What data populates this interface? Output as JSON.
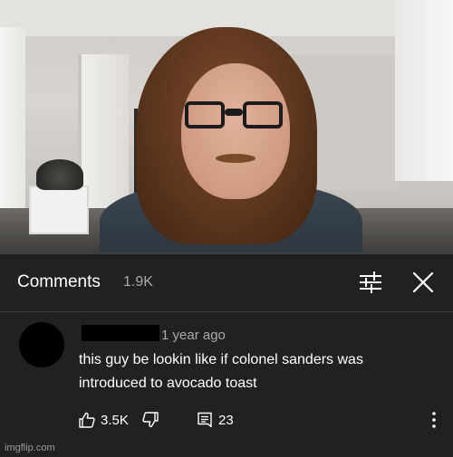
{
  "video": {
    "progress": 0.0
  },
  "comments_header": {
    "title": "Comments",
    "count": "1.9K",
    "icons": [
      "filter-icon",
      "close-icon"
    ]
  },
  "comment": {
    "time": "1 year ago",
    "text": "this guy be lookin like if colonel sanders was introduced to avocado toast",
    "likes": "3.5K",
    "replies": "23",
    "icons": [
      "thumbs-up-icon",
      "thumbs-down-icon",
      "reply-icon",
      "more-vertical-icon"
    ]
  },
  "watermark": "imgflip.com",
  "colors": {
    "background": "#212121",
    "text": "#ffffff",
    "secondary_text": "#aaaaaa",
    "progress": "#ff0000"
  }
}
